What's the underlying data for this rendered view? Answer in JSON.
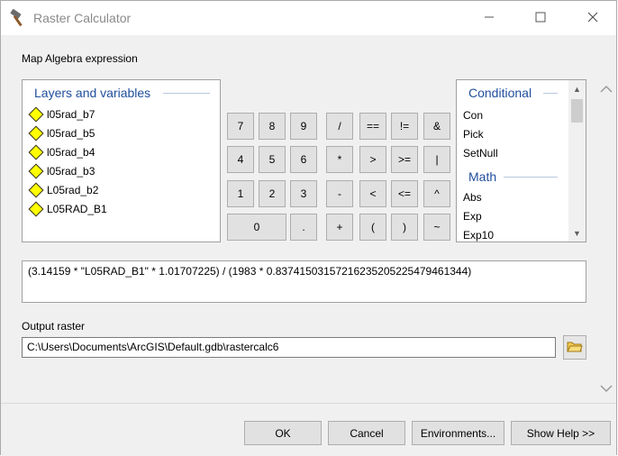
{
  "window": {
    "title": "Raster Calculator",
    "icon": "hammer-icon",
    "controls": [
      "minimize-icon",
      "maximize-icon",
      "close-icon"
    ]
  },
  "labels": {
    "map_algebra": "Map Algebra expression",
    "output_raster": "Output raster"
  },
  "layers": {
    "title": "Layers and variables",
    "items": [
      "l05rad_b7",
      "l05rad_b5",
      "l05rad_b4",
      "l05rad_b3",
      "L05rad_b2",
      "L05RAD_B1"
    ]
  },
  "calculator": {
    "keys": [
      "7",
      "8",
      "9",
      "/",
      "==",
      "!=",
      "&",
      "4",
      "5",
      "6",
      "*",
      ">",
      ">=",
      "|",
      "1",
      "2",
      "3",
      "-",
      "<",
      "<=",
      "^",
      "0",
      ".",
      "+",
      "(",
      ")",
      "~"
    ]
  },
  "functions": {
    "conditional_title": "Conditional",
    "conditional": [
      "Con",
      "Pick",
      "SetNull"
    ],
    "math_title": "Math",
    "math": [
      "Abs",
      "Exp",
      "Exp10"
    ]
  },
  "expression": "(3.14159 * \"L05RAD_B1\" * 1.01707225) / (1983 * 0.83741503157216235205225479461344)",
  "output": {
    "value": "C:\\Users\\Documents\\ArcGIS\\Default.gdb\\rastercalc6"
  },
  "buttons": {
    "ok": "OK",
    "cancel": "Cancel",
    "environments": "Environments...",
    "show_help": "Show Help >>"
  },
  "colors": {
    "group_title": "#1f4e9c",
    "layer_diamond": "#ffff00"
  }
}
